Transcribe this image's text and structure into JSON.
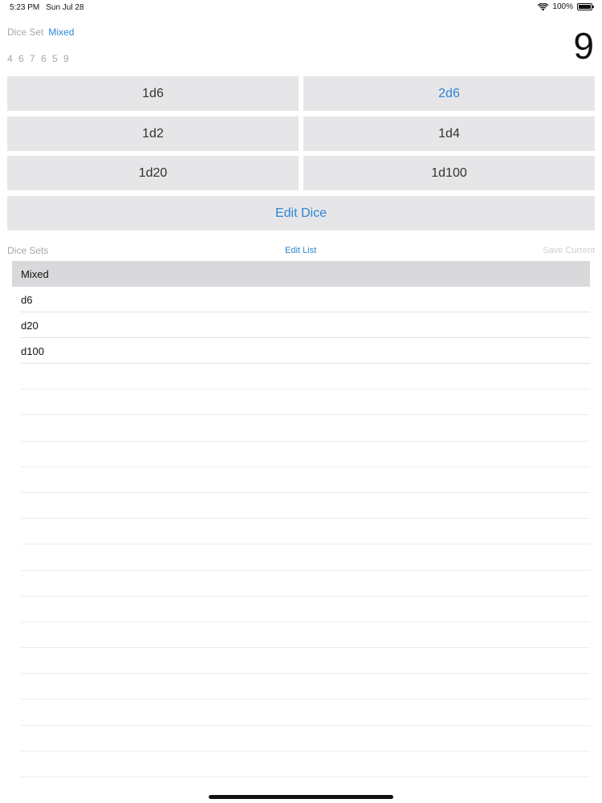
{
  "status_bar": {
    "time": "5:23 PM",
    "date": "Sun Jul 28",
    "battery_text": "100%",
    "battery_level": 1.0
  },
  "header": {
    "dice_set_label": "Dice Set",
    "dice_set_value": "Mixed",
    "roll_history": "4 6 7 6 5 9",
    "roll_total": "9"
  },
  "dice_buttons": [
    {
      "label": "1d6",
      "selected": false
    },
    {
      "label": "2d6",
      "selected": true
    },
    {
      "label": "1d2",
      "selected": false
    },
    {
      "label": "1d4",
      "selected": false
    },
    {
      "label": "1d20",
      "selected": false
    },
    {
      "label": "1d100",
      "selected": false
    }
  ],
  "edit_dice_label": "Edit Dice",
  "sets_section": {
    "title": "Dice Sets",
    "edit_list_label": "Edit List",
    "save_current_label": "Save Current",
    "items": [
      {
        "label": "Mixed",
        "selected": true
      },
      {
        "label": "d6",
        "selected": false
      },
      {
        "label": "d20",
        "selected": false
      },
      {
        "label": "d100",
        "selected": false
      }
    ]
  },
  "colors": {
    "accent": "#2d86d3",
    "button_bg": "#e6e6e8",
    "selected_row_bg": "#d9d9dc",
    "muted_text": "#a7a7a7"
  },
  "icons": {
    "wifi": "wifi-icon",
    "battery": "battery-icon"
  }
}
